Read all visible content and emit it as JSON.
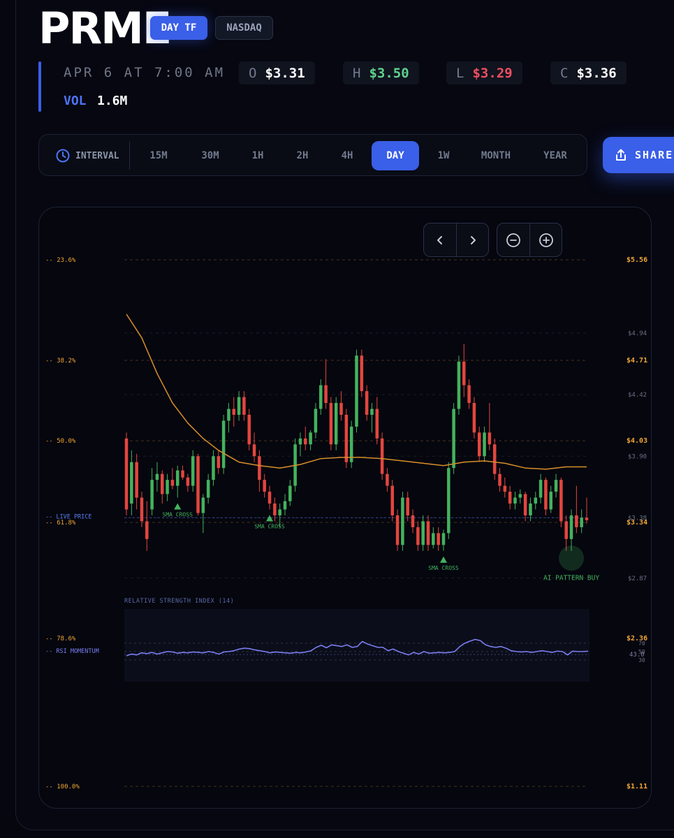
{
  "header": {
    "ticker": "PRME",
    "timeframe_badge": "DAY TF",
    "exchange_badge": "NASDAQ",
    "datetime": "APR 6 AT 7:00 AM",
    "ohlc": {
      "open_label": "O",
      "open_value": "$3.31",
      "high_label": "H",
      "high_value": "$3.50",
      "low_label": "L",
      "low_value": "$3.29",
      "close_label": "C",
      "close_value": "$3.36"
    },
    "volume_label": "VOL",
    "volume_value": "1.6M"
  },
  "interval_bar": {
    "label": "INTERVAL",
    "icon": "clock-icon",
    "options": [
      "15M",
      "30M",
      "1H",
      "2H",
      "4H",
      "DAY",
      "1W",
      "MONTH",
      "YEAR"
    ],
    "selected": "DAY"
  },
  "share_button": {
    "label": "SHARE",
    "icon": "share-icon"
  },
  "chart_controls": {
    "icons": [
      "chevron-left-icon",
      "chevron-right-icon",
      "zoom-out-icon",
      "zoom-in-icon"
    ]
  },
  "colors": {
    "accent": "#3a5fe8",
    "up": "#44b25e",
    "down": "#e2463f",
    "fib": "#f0a634",
    "ma": "#d88f2b",
    "rsi": "#7b7df0",
    "high_value": "#5fd38d",
    "low_value": "#ef4e60"
  },
  "chart_data": {
    "type": "candlestick",
    "fib_levels": [
      {
        "label": "-- 23.6%",
        "price_label": "$5.56",
        "price": 5.56
      },
      {
        "label": "-- 38.2%",
        "price_label": "$4.71",
        "price": 4.71
      },
      {
        "label": "-- 50.0%",
        "price_label": "$4.03",
        "price": 4.03
      },
      {
        "label": "-- 61.8%",
        "price_label": "$3.34",
        "price": 3.34
      },
      {
        "label": "-- 78.6%",
        "price_label": "$2.36",
        "price": 2.36
      },
      {
        "label": "-- 100.0%",
        "price_label": "$1.11",
        "price": 1.11
      }
    ],
    "price_axis_ticks": [
      "$4.94",
      "$4.42",
      "$3.90",
      "$3.38",
      "$2.87"
    ],
    "price_axis_values": [
      4.94,
      4.42,
      3.9,
      3.38,
      2.87
    ],
    "live_price_label": "-- LIVE PRICE",
    "live_price_value": 3.38,
    "markers": [
      {
        "label": "SMA CROSS",
        "index": 10
      },
      {
        "label": "SMA CROSS",
        "index": 28
      },
      {
        "label": "SMA CROSS",
        "index": 62
      }
    ],
    "ai_signal": {
      "label": "AI PATTERN BUY",
      "index": 87,
      "price": 3.05
    },
    "candles": [
      {
        "o": 4.05,
        "h": 4.1,
        "l": 3.4,
        "c": 3.45
      },
      {
        "o": 3.5,
        "h": 3.95,
        "l": 3.4,
        "c": 3.85
      },
      {
        "o": 3.85,
        "h": 3.92,
        "l": 3.45,
        "c": 3.55
      },
      {
        "o": 3.55,
        "h": 3.6,
        "l": 3.3,
        "c": 3.35
      },
      {
        "o": 3.35,
        "h": 3.52,
        "l": 3.1,
        "c": 3.2
      },
      {
        "o": 3.45,
        "h": 3.8,
        "l": 3.4,
        "c": 3.7
      },
      {
        "o": 3.7,
        "h": 3.85,
        "l": 3.6,
        "c": 3.75
      },
      {
        "o": 3.75,
        "h": 3.78,
        "l": 3.5,
        "c": 3.58
      },
      {
        "o": 3.58,
        "h": 3.75,
        "l": 3.52,
        "c": 3.7
      },
      {
        "o": 3.7,
        "h": 3.8,
        "l": 3.62,
        "c": 3.65
      },
      {
        "o": 3.65,
        "h": 3.82,
        "l": 3.55,
        "c": 3.78
      },
      {
        "o": 3.78,
        "h": 3.82,
        "l": 3.7,
        "c": 3.72
      },
      {
        "o": 3.72,
        "h": 3.75,
        "l": 3.6,
        "c": 3.65
      },
      {
        "o": 3.65,
        "h": 3.95,
        "l": 3.6,
        "c": 3.9
      },
      {
        "o": 3.9,
        "h": 3.92,
        "l": 3.4,
        "c": 3.42
      },
      {
        "o": 3.42,
        "h": 3.58,
        "l": 3.25,
        "c": 3.55
      },
      {
        "o": 3.55,
        "h": 3.75,
        "l": 3.5,
        "c": 3.7
      },
      {
        "o": 3.7,
        "h": 3.95,
        "l": 3.65,
        "c": 3.9
      },
      {
        "o": 3.9,
        "h": 3.95,
        "l": 3.75,
        "c": 3.8
      },
      {
        "o": 3.8,
        "h": 4.25,
        "l": 3.75,
        "c": 4.2
      },
      {
        "o": 4.2,
        "h": 4.35,
        "l": 4.1,
        "c": 4.3
      },
      {
        "o": 4.3,
        "h": 4.4,
        "l": 4.15,
        "c": 4.25
      },
      {
        "o": 4.25,
        "h": 4.45,
        "l": 4.2,
        "c": 4.4
      },
      {
        "o": 4.4,
        "h": 4.45,
        "l": 4.2,
        "c": 4.25
      },
      {
        "o": 4.25,
        "h": 4.3,
        "l": 3.95,
        "c": 4.0
      },
      {
        "o": 4.0,
        "h": 4.1,
        "l": 3.85,
        "c": 3.9
      },
      {
        "o": 3.9,
        "h": 3.95,
        "l": 3.6,
        "c": 3.7
      },
      {
        "o": 3.7,
        "h": 3.75,
        "l": 3.55,
        "c": 3.6
      },
      {
        "o": 3.6,
        "h": 3.65,
        "l": 3.45,
        "c": 3.5
      },
      {
        "o": 3.5,
        "h": 3.55,
        "l": 3.35,
        "c": 3.4
      },
      {
        "o": 3.4,
        "h": 3.5,
        "l": 3.3,
        "c": 3.45
      },
      {
        "o": 3.45,
        "h": 3.58,
        "l": 3.4,
        "c": 3.52
      },
      {
        "o": 3.52,
        "h": 3.7,
        "l": 3.48,
        "c": 3.65
      },
      {
        "o": 3.65,
        "h": 4.05,
        "l": 3.6,
        "c": 4.0
      },
      {
        "o": 4.0,
        "h": 4.1,
        "l": 3.9,
        "c": 4.05
      },
      {
        "o": 4.05,
        "h": 4.15,
        "l": 3.95,
        "c": 4.0
      },
      {
        "o": 4.0,
        "h": 4.12,
        "l": 3.95,
        "c": 4.1
      },
      {
        "o": 4.1,
        "h": 4.35,
        "l": 4.05,
        "c": 4.3
      },
      {
        "o": 4.3,
        "h": 4.55,
        "l": 4.25,
        "c": 4.5
      },
      {
        "o": 4.5,
        "h": 4.72,
        "l": 4.3,
        "c": 4.35
      },
      {
        "o": 4.35,
        "h": 4.4,
        "l": 3.95,
        "c": 4.0
      },
      {
        "o": 4.0,
        "h": 4.4,
        "l": 3.95,
        "c": 4.35
      },
      {
        "o": 4.35,
        "h": 4.45,
        "l": 4.2,
        "c": 4.25
      },
      {
        "o": 4.25,
        "h": 4.3,
        "l": 3.8,
        "c": 3.85
      },
      {
        "o": 3.85,
        "h": 4.2,
        "l": 3.8,
        "c": 4.15
      },
      {
        "o": 4.15,
        "h": 4.8,
        "l": 4.1,
        "c": 4.75
      },
      {
        "o": 4.75,
        "h": 4.8,
        "l": 4.4,
        "c": 4.45
      },
      {
        "o": 4.45,
        "h": 4.5,
        "l": 4.2,
        "c": 4.25
      },
      {
        "o": 4.25,
        "h": 4.35,
        "l": 4.1,
        "c": 4.3
      },
      {
        "o": 4.3,
        "h": 4.4,
        "l": 4.0,
        "c": 4.05
      },
      {
        "o": 4.05,
        "h": 4.1,
        "l": 3.7,
        "c": 3.75
      },
      {
        "o": 3.75,
        "h": 3.8,
        "l": 3.6,
        "c": 3.65
      },
      {
        "o": 3.65,
        "h": 3.7,
        "l": 3.35,
        "c": 3.4
      },
      {
        "o": 3.4,
        "h": 3.45,
        "l": 3.1,
        "c": 3.15
      },
      {
        "o": 3.15,
        "h": 3.6,
        "l": 3.1,
        "c": 3.55
      },
      {
        "o": 3.55,
        "h": 3.6,
        "l": 3.35,
        "c": 3.4
      },
      {
        "o": 3.4,
        "h": 3.45,
        "l": 3.25,
        "c": 3.3
      },
      {
        "o": 3.3,
        "h": 3.35,
        "l": 3.1,
        "c": 3.15
      },
      {
        "o": 3.15,
        "h": 3.4,
        "l": 3.1,
        "c": 3.35
      },
      {
        "o": 3.35,
        "h": 3.4,
        "l": 3.1,
        "c": 3.15
      },
      {
        "o": 3.15,
        "h": 3.3,
        "l": 3.12,
        "c": 3.25
      },
      {
        "o": 3.25,
        "h": 3.3,
        "l": 3.1,
        "c": 3.15
      },
      {
        "o": 3.15,
        "h": 3.28,
        "l": 3.1,
        "c": 3.25
      },
      {
        "o": 3.25,
        "h": 3.85,
        "l": 3.2,
        "c": 3.8
      },
      {
        "o": 3.8,
        "h": 4.35,
        "l": 3.75,
        "c": 4.3
      },
      {
        "o": 4.3,
        "h": 4.75,
        "l": 4.25,
        "c": 4.7
      },
      {
        "o": 4.7,
        "h": 4.85,
        "l": 4.4,
        "c": 4.5
      },
      {
        "o": 4.5,
        "h": 4.55,
        "l": 4.3,
        "c": 4.35
      },
      {
        "o": 4.35,
        "h": 4.4,
        "l": 4.05,
        "c": 4.1
      },
      {
        "o": 4.1,
        "h": 4.15,
        "l": 3.85,
        "c": 3.9
      },
      {
        "o": 3.9,
        "h": 4.15,
        "l": 3.85,
        "c": 4.1
      },
      {
        "o": 4.1,
        "h": 4.35,
        "l": 3.95,
        "c": 4.0
      },
      {
        "o": 4.0,
        "h": 4.05,
        "l": 3.7,
        "c": 3.75
      },
      {
        "o": 3.75,
        "h": 3.8,
        "l": 3.6,
        "c": 3.65
      },
      {
        "o": 3.65,
        "h": 3.72,
        "l": 3.55,
        "c": 3.6
      },
      {
        "o": 3.6,
        "h": 3.65,
        "l": 3.45,
        "c": 3.5
      },
      {
        "o": 3.5,
        "h": 3.6,
        "l": 3.45,
        "c": 3.55
      },
      {
        "o": 3.55,
        "h": 3.62,
        "l": 3.5,
        "c": 3.58
      },
      {
        "o": 3.58,
        "h": 3.6,
        "l": 3.35,
        "c": 3.4
      },
      {
        "o": 3.4,
        "h": 3.55,
        "l": 3.35,
        "c": 3.5
      },
      {
        "o": 3.5,
        "h": 3.6,
        "l": 3.45,
        "c": 3.55
      },
      {
        "o": 3.55,
        "h": 3.75,
        "l": 3.5,
        "c": 3.7
      },
      {
        "o": 3.7,
        "h": 3.72,
        "l": 3.4,
        "c": 3.45
      },
      {
        "o": 3.45,
        "h": 3.65,
        "l": 3.42,
        "c": 3.6
      },
      {
        "o": 3.6,
        "h": 3.75,
        "l": 3.55,
        "c": 3.7
      },
      {
        "o": 3.7,
        "h": 3.72,
        "l": 3.3,
        "c": 3.35
      },
      {
        "o": 3.35,
        "h": 3.4,
        "l": 3.1,
        "c": 3.2
      },
      {
        "o": 3.2,
        "h": 3.45,
        "l": 3.1,
        "c": 3.4
      },
      {
        "o": 3.4,
        "h": 3.65,
        "l": 3.25,
        "c": 3.3
      },
      {
        "o": 3.3,
        "h": 3.45,
        "l": 3.25,
        "c": 3.38
      },
      {
        "o": 3.38,
        "h": 3.55,
        "l": 3.33,
        "c": 3.36
      }
    ],
    "moving_average": {
      "x_index": [
        0,
        3,
        6,
        9,
        12,
        15,
        18,
        22,
        26,
        30,
        34,
        38,
        42,
        46,
        50,
        54,
        58,
        62,
        66,
        70,
        74,
        78,
        82,
        86,
        90
      ],
      "values": [
        5.1,
        4.9,
        4.6,
        4.35,
        4.18,
        4.05,
        3.95,
        3.85,
        3.82,
        3.8,
        3.83,
        3.88,
        3.89,
        3.89,
        3.88,
        3.86,
        3.84,
        3.82,
        3.85,
        3.86,
        3.84,
        3.8,
        3.79,
        3.81,
        3.81
      ]
    },
    "rsi": {
      "title": "RELATIVE STRENGTH INDEX (14)",
      "label": "-- RSI MOMENTUM",
      "levels": [
        70,
        50,
        30
      ],
      "level_labels": [
        "70",
        "50",
        "30"
      ],
      "current_label": "43.0",
      "current": 43.0,
      "values": [
        40,
        44,
        42,
        47,
        45,
        48,
        44,
        47,
        50,
        49,
        46,
        48,
        47,
        49,
        48,
        47,
        50,
        48,
        44,
        49,
        50,
        52,
        56,
        58,
        57,
        54,
        52,
        50,
        47,
        49,
        48,
        47,
        46,
        48,
        47,
        49,
        52,
        60,
        65,
        59,
        66,
        64,
        62,
        66,
        60,
        62,
        74,
        68,
        64,
        60,
        60,
        52,
        56,
        50,
        46,
        42,
        48,
        44,
        50,
        46,
        47,
        48,
        47,
        48,
        50,
        62,
        70,
        75,
        79,
        76,
        66,
        62,
        60,
        62,
        58,
        52,
        50,
        49,
        50,
        48,
        50,
        52,
        50,
        48,
        51,
        50,
        42,
        51,
        50,
        50,
        51
      ]
    }
  }
}
